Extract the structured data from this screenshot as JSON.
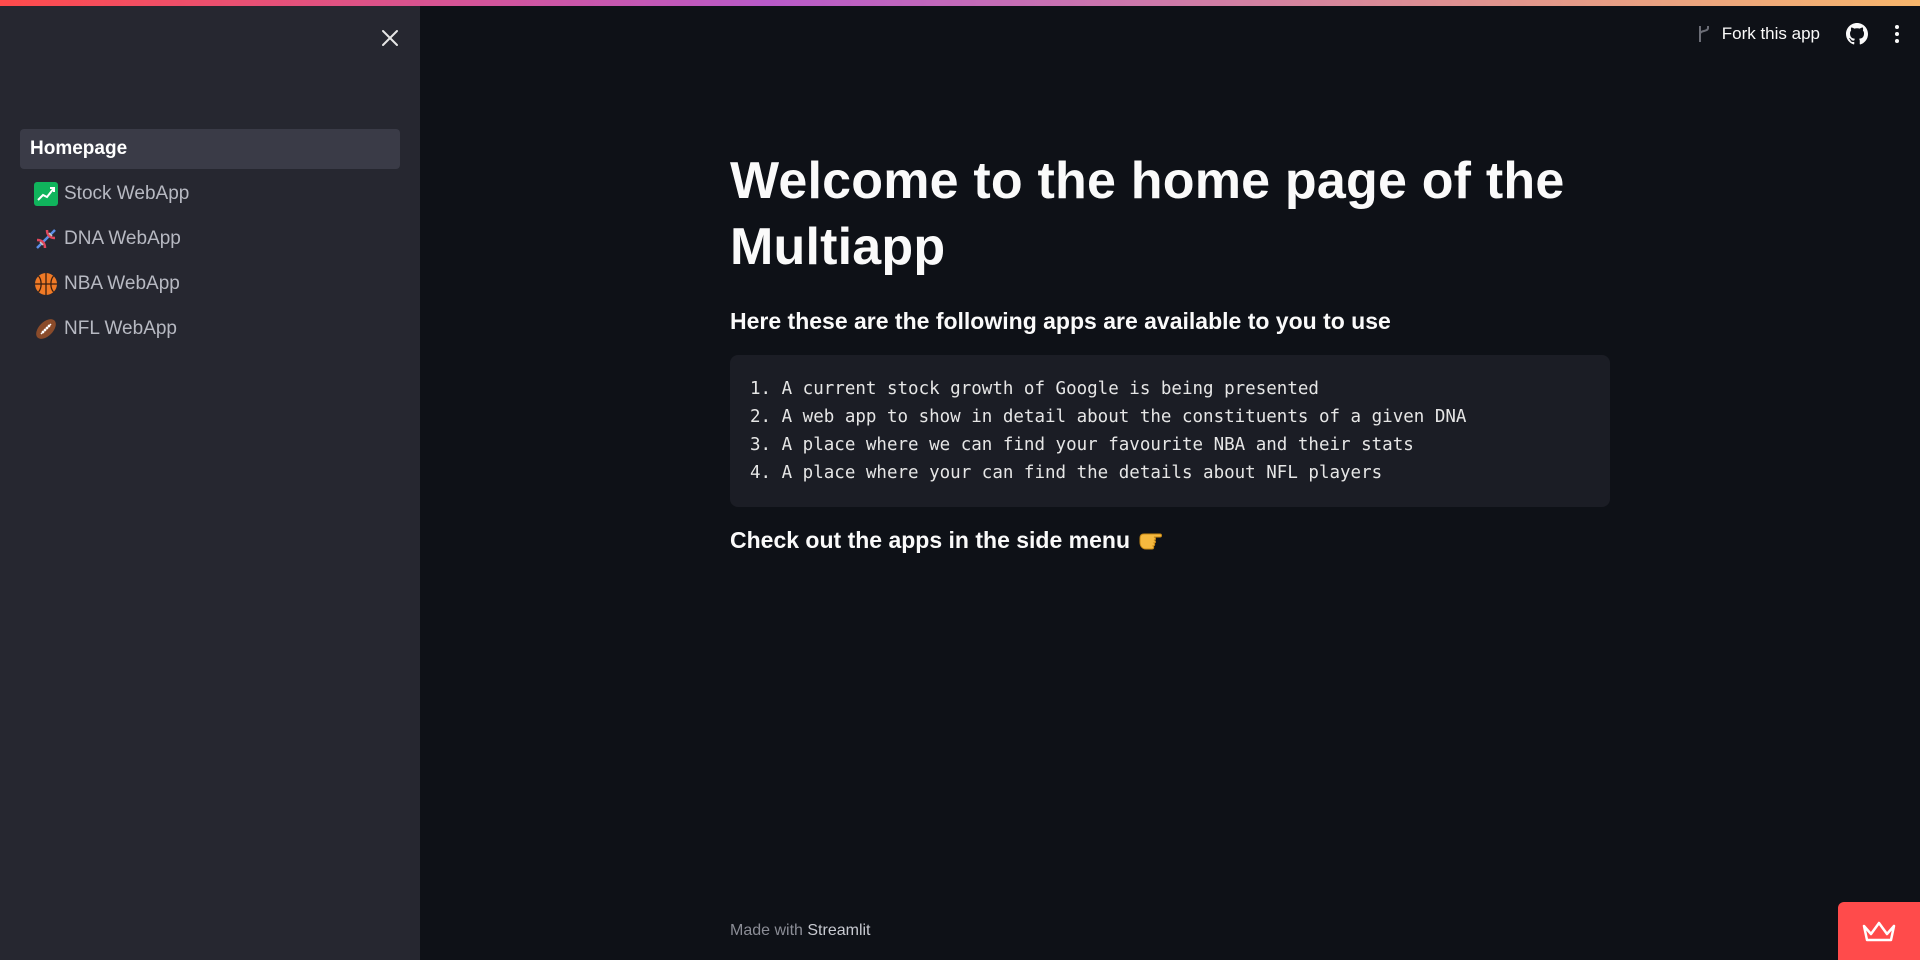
{
  "sidebar": {
    "items": [
      {
        "label": "Homepage",
        "icon": "none",
        "active": true
      },
      {
        "label": "Stock WebApp",
        "icon": "chart-increasing-icon",
        "active": false
      },
      {
        "label": "DNA WebApp",
        "icon": "dna-icon",
        "active": false
      },
      {
        "label": "NBA WebApp",
        "icon": "basketball-icon",
        "active": false
      },
      {
        "label": "NFL WebApp",
        "icon": "american-football-icon",
        "active": false
      }
    ]
  },
  "header": {
    "fork_label": "Fork this app",
    "github_icon": "github-icon",
    "menu_icon": "kebab-menu-icon"
  },
  "main": {
    "title": "Welcome to the home page of the Multiapp",
    "subtitle": "Here these are the following apps are available to you to use",
    "code_lines": [
      "1. A current stock growth of Google is being presented",
      "2. A web app to show in detail about the constituents of a given DNA",
      "3. A place where we can find your favourite NBA and their stats",
      "4. A place where your can find the details about NFL players"
    ],
    "check_text": "Check out the apps in the side menu",
    "check_icon": "pointing-hand-icon"
  },
  "footer": {
    "made_with": "Made with",
    "brand": "Streamlit"
  },
  "colors": {
    "background": "#0e1117",
    "sidebar": "#262730",
    "accent": "#ff4b4b"
  }
}
